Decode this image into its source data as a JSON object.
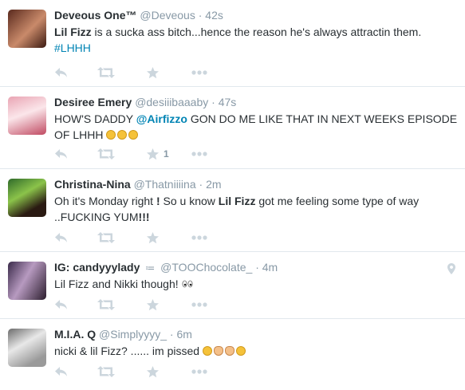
{
  "colors": {
    "link": "#0084b4",
    "muted": "#8899a6",
    "icon": "#ccd6dd",
    "divider": "#e1e8ed"
  },
  "tweets": [
    {
      "name": "Deveous One™",
      "handle": "@Deveous",
      "separator": "·",
      "time": "42s",
      "text_parts": [
        {
          "bold": "Lil Fizz"
        },
        {
          "text": " is a sucka ass bitch...hence the reason he's always attractin them."
        },
        {
          "hashtag": "#LHHH"
        }
      ],
      "favorite_count": ""
    },
    {
      "name": "Desiree Emery",
      "handle": "@desiiibaaaby",
      "separator": "·",
      "time": "47s",
      "text_parts": [
        {
          "text": "HOW'S DADDY "
        },
        {
          "mention": "@Airfizzo"
        },
        {
          "text": " GON DO ME LIKE THAT IN NEXT WEEKS EPISODE OF LHHH"
        }
      ],
      "emojis": [
        "worried-face-emoji",
        "worried-face-emoji",
        "worried-face-emoji"
      ],
      "favorite_count": "1"
    },
    {
      "name": "Christina-Nina",
      "handle": "@Thatniiiina",
      "separator": "·",
      "time": "2m",
      "text_parts": [
        {
          "text": "Oh it's Monday right "
        },
        {
          "bold": "!"
        },
        {
          "text": " So u know "
        },
        {
          "bold": "Lil Fizz"
        },
        {
          "text": " got me feeling some type of way ..FUCKING YUM"
        },
        {
          "bold": "!!!"
        }
      ],
      "favorite_count": ""
    },
    {
      "name": "IG: candyyylady",
      "badge": "≔",
      "handle": "@TOOChocolate_",
      "separator": "·",
      "time": "4m",
      "text_parts": [
        {
          "text": "Lil Fizz and Nikki though! "
        }
      ],
      "emojis": [
        "eyes-emoji"
      ],
      "geo": "location-pin-icon",
      "favorite_count": ""
    },
    {
      "name": "M.I.A. Q",
      "handle": "@Simplyyyy_",
      "separator": "·",
      "time": "6m",
      "text_parts": [
        {
          "text": "nicki & lil Fizz? ...... im pissed "
        }
      ],
      "emojis": [
        "expressionless-face-emoji",
        "ok-hand-emoji",
        "ok-hand-emoji",
        "unamused-face-emoji"
      ],
      "favorite_count": ""
    }
  ]
}
